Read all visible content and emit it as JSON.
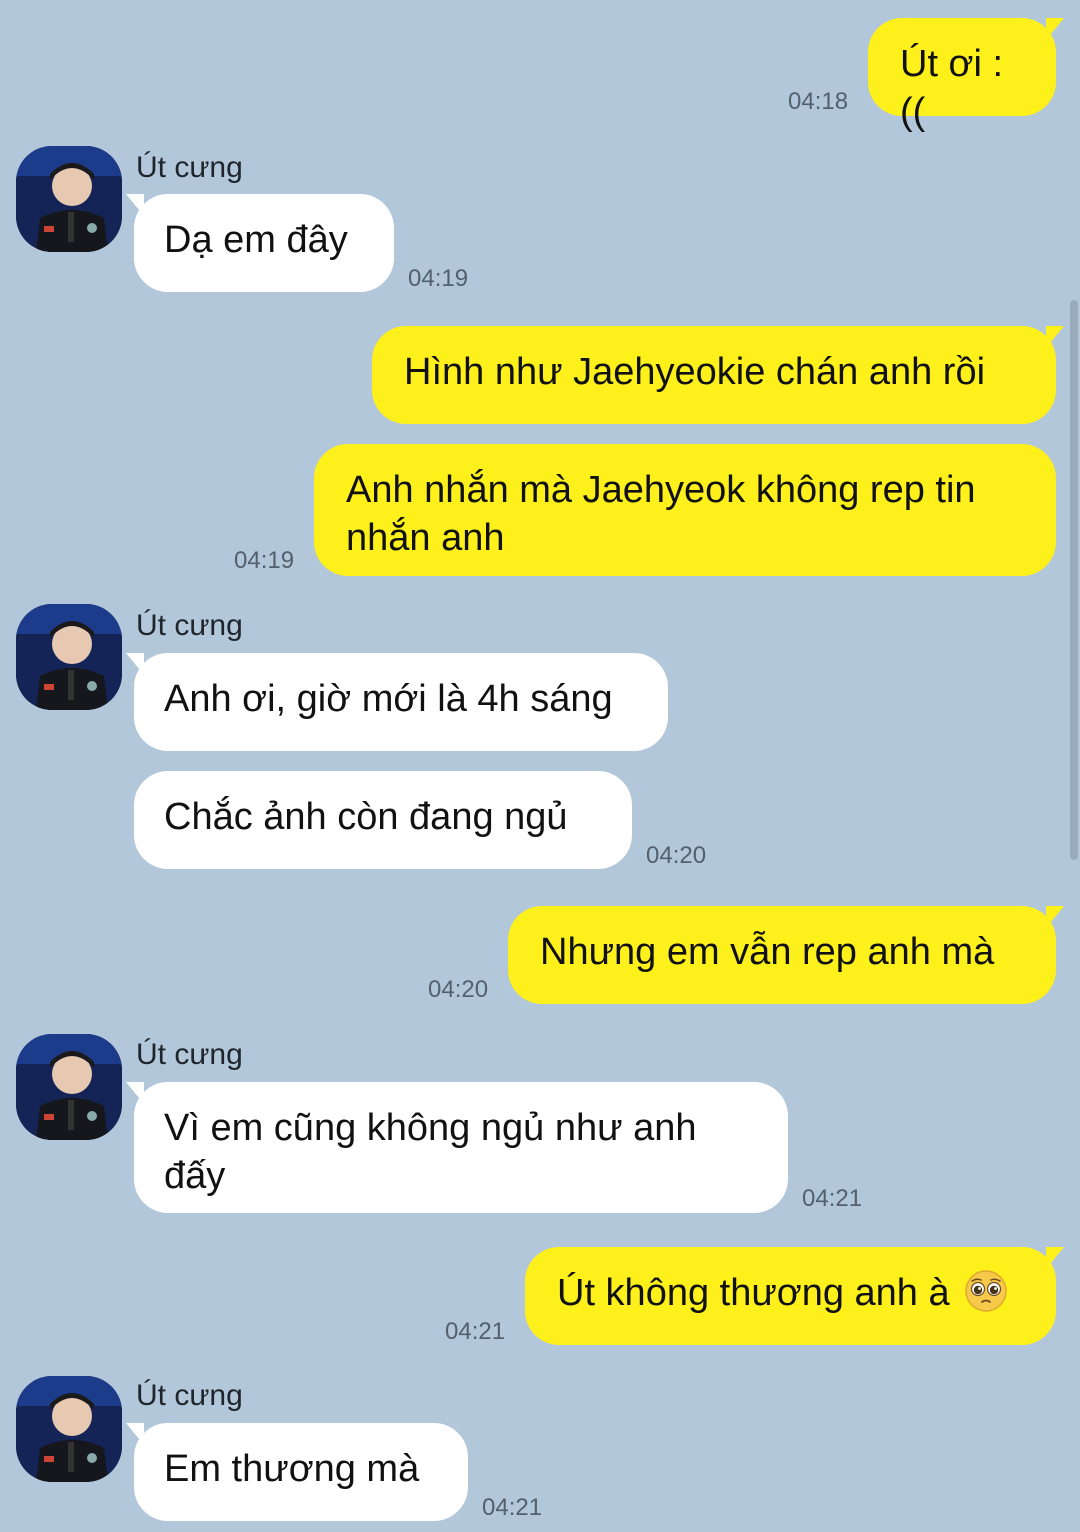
{
  "contact": {
    "name": "Út cưng"
  },
  "messages": [
    {
      "from": "me",
      "text": "Út ơi :((",
      "time": "04:18"
    },
    {
      "from": "them",
      "text": "Dạ em đây",
      "time": "04:19"
    },
    {
      "from": "me",
      "text": "Hình như Jaehyeokie chán anh rồi",
      "time": ""
    },
    {
      "from": "me",
      "text": "Anh nhắn mà Jaehyeok không rep tin nhắn anh",
      "time": "04:19"
    },
    {
      "from": "them",
      "text": "Anh ơi, giờ mới là 4h sáng",
      "time": ""
    },
    {
      "from": "them",
      "text": "Chắc ảnh còn đang ngủ",
      "time": "04:20"
    },
    {
      "from": "me",
      "text": "Nhưng em vẫn rep anh mà",
      "time": "04:20"
    },
    {
      "from": "them",
      "text": "Vì em cũng không ngủ như anh đấy",
      "time": "04:21"
    },
    {
      "from": "me",
      "text": "Út không thương anh à",
      "emoji": "pleading-face-emoji",
      "time": "04:21"
    },
    {
      "from": "them",
      "text": "Em thương mà",
      "time": "04:21"
    }
  ],
  "colors": {
    "background": "#b2c7da",
    "my_bubble": "#fef01b",
    "their_bubble": "#ffffff",
    "timestamp": "#53606d"
  }
}
